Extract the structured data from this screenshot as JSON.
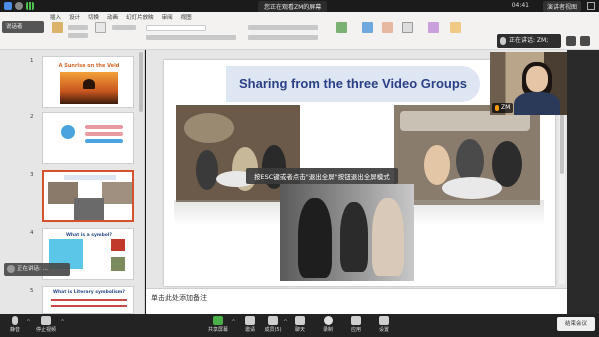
{
  "window": {
    "title": "您正在观看ZM的屏幕",
    "time": "04:41",
    "view_options": "演讲者视图",
    "speaking_left": "说话者",
    "speaking_right": "正在讲话: ZM;"
  },
  "ribbon": {
    "tabs": [
      "文件",
      "开始",
      "插入",
      "设计",
      "切换",
      "动画",
      "幻灯片放映",
      "审阅",
      "视图"
    ],
    "active_tab": "开始"
  },
  "thumbnails": {
    "slide1_title": "A Sunrise on the Veld",
    "slide4_title": "What is a symbol?",
    "slide5_title": "What is Literary symbolism?",
    "slide3_title": "Sharing from the three Video Groups"
  },
  "slide": {
    "title": "Sharing from the three Video Groups",
    "esc_tip": "按ESC键或者点击\"退出全屏\"按钮退出全屏模式",
    "notes_placeholder": "单击此处添加备注"
  },
  "video": {
    "name": "ZM"
  },
  "mini_speaker": "正在讲话: ...",
  "toolbar": {
    "mute": "静音",
    "stop_video": "停止视频",
    "share_screen": "共享屏幕",
    "invite": "邀请",
    "participants": "成员(5)",
    "chat": "聊天",
    "record": "录制",
    "apps": "应用",
    "settings": "设置",
    "end": "结束会议"
  },
  "colors": {
    "accent": "#d35230",
    "title_blue": "#2b3f86",
    "toolbar_bg": "#232323"
  }
}
